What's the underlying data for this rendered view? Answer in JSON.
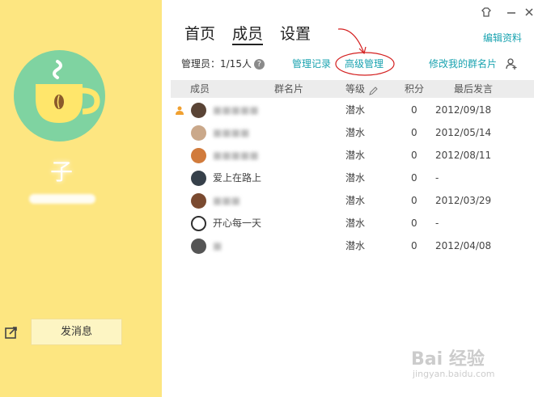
{
  "left_panel": {
    "group_name": "子",
    "send_message_label": "发消息",
    "bg_color": "#fde681",
    "avatar_color": "#7fd3a1"
  },
  "tabs": [
    {
      "label": "首页",
      "active": false
    },
    {
      "label": "成员",
      "active": true
    },
    {
      "label": "设置",
      "active": false
    }
  ],
  "edit_info_label": "编辑资料",
  "toolbar": {
    "admin_label": "管理员：1/15人",
    "manage_log_label": "管理记录",
    "advanced_manage_label": "高级管理",
    "edit_card_label": "修改我的群名片"
  },
  "table": {
    "headers": [
      "成员",
      "群名片",
      "等级",
      "积分",
      "最后发言"
    ],
    "rows": [
      {
        "name": "",
        "level": "潜水",
        "points": "0",
        "last": "2012/09/18",
        "avatar_color": "#5a4436",
        "admin": true
      },
      {
        "name": "",
        "level": "潜水",
        "points": "0",
        "last": "2012/05/14",
        "avatar_color": "#caa88a",
        "admin": false
      },
      {
        "name": "",
        "level": "潜水",
        "points": "0",
        "last": "2012/08/11",
        "avatar_color": "#d17b3c",
        "admin": false
      },
      {
        "name": "爱上在路上",
        "level": "潜水",
        "points": "0",
        "last": "-",
        "avatar_color": "#36404a",
        "admin": false
      },
      {
        "name": "",
        "level": "潜水",
        "points": "0",
        "last": "2012/03/29",
        "avatar_color": "#7a4a30",
        "admin": false
      },
      {
        "name": "开心每一天",
        "level": "潜水",
        "points": "0",
        "last": "-",
        "avatar_color": "#2f2f2f",
        "admin": false
      },
      {
        "name": "",
        "level": "潜水",
        "points": "0",
        "last": "2012/04/08",
        "avatar_color": "#555555",
        "admin": false
      }
    ]
  },
  "watermark": {
    "text": "Bai 经验",
    "sub": "jingyan.baidu.com"
  },
  "colors": {
    "accent_link": "#1aa3b0",
    "annotation_red": "#d42020"
  }
}
